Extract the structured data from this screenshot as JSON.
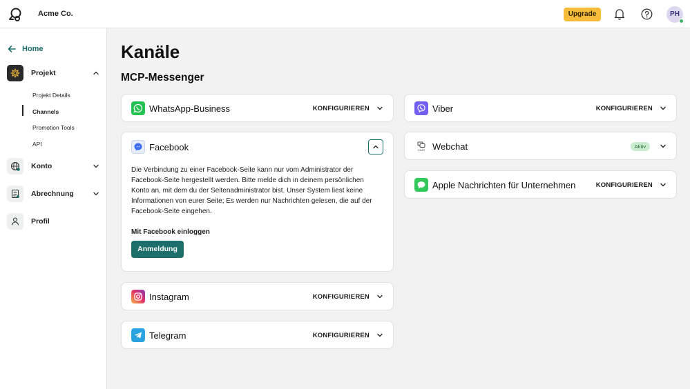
{
  "topbar": {
    "org_name": "Acme Co.",
    "upgrade_label": "Upgrade",
    "avatar_initials": "PH",
    "colors": {
      "upgrade": "#f7bd3a",
      "online": "#3fb56b"
    }
  },
  "sidebar": {
    "home_label": "Home",
    "groups": [
      {
        "label": "Projekt",
        "icon": "gear-icon",
        "expanded": true
      },
      {
        "label": "Konto",
        "icon": "globe-icon",
        "expanded": false
      },
      {
        "label": "Abrechnung",
        "icon": "invoice-icon",
        "expanded": false
      },
      {
        "label": "Profil",
        "icon": "person-icon"
      }
    ],
    "sub_items": [
      "Projekt Details",
      "Channels",
      "Promotion Tools",
      "API"
    ],
    "active_sub_item": "Channels"
  },
  "main": {
    "title": "Kanäle",
    "section": "MCP-Messenger",
    "configure_label": "KONFIGURIEREN",
    "active_label": "Aktiv",
    "channels": {
      "whatsapp": {
        "name": "WhatsApp-Business",
        "icon": "whatsapp-icon"
      },
      "facebook": {
        "name": "Facebook",
        "icon": "messenger-icon",
        "description": "Die Verbindung zu einer Facebook-Seite kann nur vom Administrator der Facebook-Seite hergestellt werden. Bitte melde dich in deinem persönlichen Konto an, mit dem du der Seitenadministrator bist. Unser System liest keine Informationen von eurer Seite; Es werden nur Nachrichten gelesen, die auf der Facebook-Seite eingehen.",
        "login_title": "Mit Facebook einloggen",
        "login_button": "Anmeldung"
      },
      "instagram": {
        "name": "Instagram",
        "icon": "instagram-icon"
      },
      "telegram": {
        "name": "Telegram",
        "icon": "telegram-icon"
      },
      "viber": {
        "name": "Viber",
        "icon": "viber-icon"
      },
      "webchat": {
        "name": "Webchat",
        "icon": "chat-icon",
        "icon_caption": "CHAT"
      },
      "apple": {
        "name": "Apple Nachrichten für Unternehmen",
        "icon": "apple-messages-icon"
      }
    },
    "colors": {
      "primary": "#1d6f6b",
      "active_badge": "#c9ebcf"
    }
  }
}
